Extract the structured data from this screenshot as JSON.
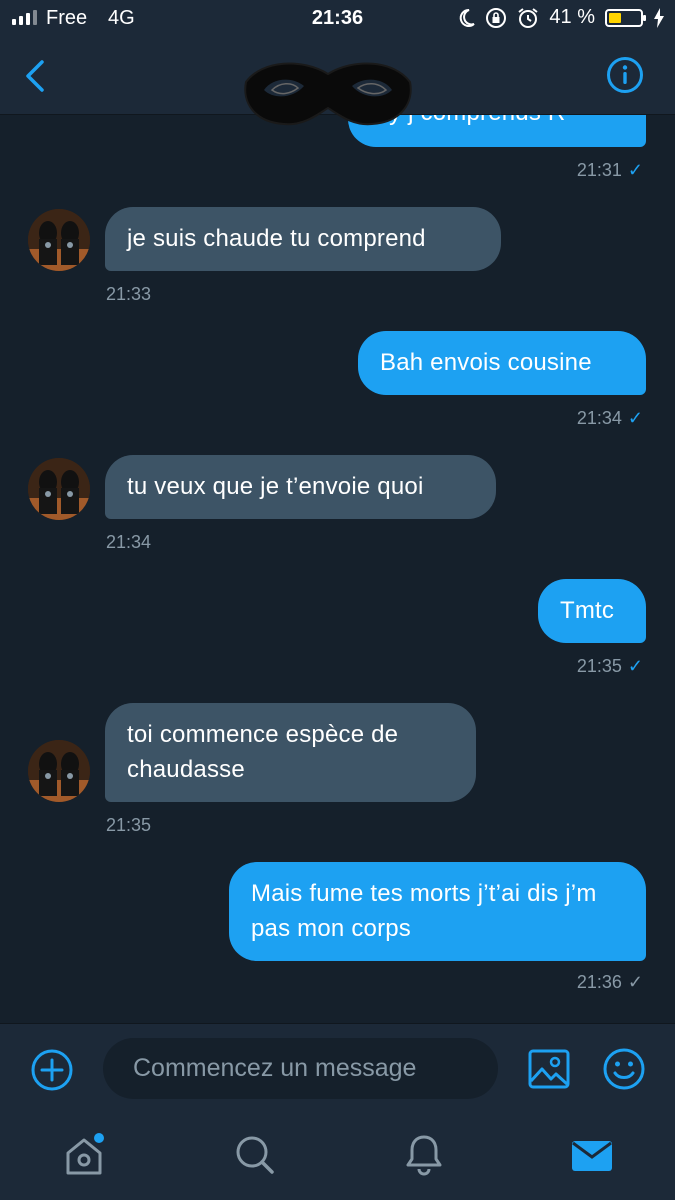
{
  "status_bar": {
    "carrier": "Free",
    "network": "4G",
    "time": "21:36",
    "battery_percent": "41 %",
    "battery_level": 0.41,
    "icons": [
      "signal-icon",
      "moon-icon",
      "rotation-lock-icon",
      "alarm-icon",
      "battery-icon",
      "charging-bolt-icon"
    ]
  },
  "header": {
    "icons": [
      "back-chevron-icon",
      "info-icon"
    ]
  },
  "messages": [
    {
      "direction": "out",
      "text": "s y j comprends R",
      "time": "21:31",
      "status": "read"
    },
    {
      "direction": "in",
      "text": "je suis chaude tu comprend",
      "time": "21:33"
    },
    {
      "direction": "out",
      "text": "Bah envois cousine",
      "time": "21:34",
      "status": "read"
    },
    {
      "direction": "in",
      "text": "tu veux que je t’envoie quoi",
      "time": "21:34"
    },
    {
      "direction": "out",
      "text": "Tmtc",
      "time": "21:35",
      "status": "read"
    },
    {
      "direction": "in",
      "text": "toi commence espèce de chaudasse",
      "time": "21:35"
    },
    {
      "direction": "out",
      "text": "Mais fume tes morts j’t’ai dis j’m pas mon corps",
      "time": "21:36",
      "status": "sent"
    }
  ],
  "composer": {
    "placeholder": "Commencez un message",
    "icons": [
      "add-circle-icon",
      "image-icon",
      "emoji-icon"
    ]
  },
  "tabbar": {
    "items": [
      {
        "name": "home",
        "icon": "home-icon",
        "badge": true
      },
      {
        "name": "search",
        "icon": "search-icon"
      },
      {
        "name": "notifications",
        "icon": "bell-icon"
      },
      {
        "name": "messages",
        "icon": "mail-icon",
        "active": true
      }
    ]
  },
  "colors": {
    "background": "#15202b",
    "bar": "#1c2938",
    "accent": "#1da1f2",
    "incoming_bubble": "#3d5466",
    "muted": "#8899a6",
    "battery": "#ffd400"
  }
}
